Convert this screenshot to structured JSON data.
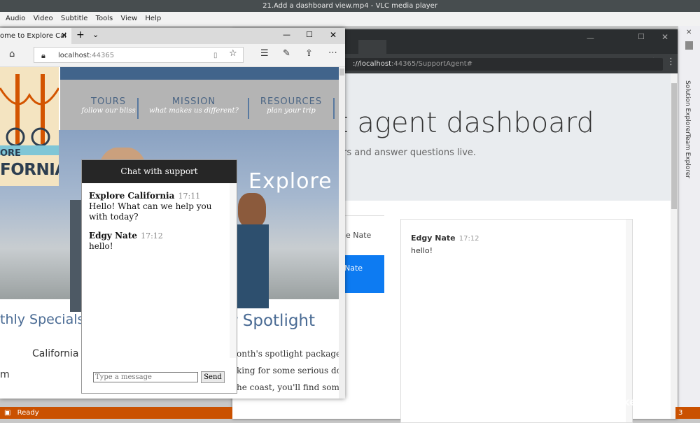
{
  "vlc": {
    "title": "21.Add a dashboard view.mp4 - VLC media player",
    "menu": [
      "Audio",
      "Video",
      "Subtitle",
      "Tools",
      "View",
      "Help"
    ]
  },
  "vs": {
    "tabs": [
      "Solution Explorer",
      "Team Explorer"
    ],
    "status": "Ready",
    "status_right": "3"
  },
  "chrome": {
    "url_prefix": "://localhost",
    "url_suffix": ":44365/SupportAgent#",
    "dash_title": "t agent dashboard",
    "dash_subtitle": "ers and answer questions live.",
    "agent_inactive": "he Nate",
    "agent_active": "Nate",
    "messages": [
      {
        "name": "Edgy Nate",
        "time": "17:12",
        "text": "hello!"
      }
    ]
  },
  "edge": {
    "tab_title": "ome to Explore Cal",
    "url_host": "localhost",
    "url_port": ":44365"
  },
  "page": {
    "nav": [
      {
        "title": "TOURS",
        "sub": "follow our bliss"
      },
      {
        "title": "MISSION",
        "sub": "what makes us different?"
      },
      {
        "title": "RESOURCES",
        "sub": "plan your trip"
      }
    ],
    "logo_top": "ORE",
    "logo_bottom": "FORNIA",
    "hero_text": "Explore",
    "monthly": "thly Specials",
    "spotlight": "r Spotlight",
    "california": "California",
    "spot_lines": [
      "onth's spotlight package is",
      "king for some serious dow",
      "he coast, you'll find someth"
    ]
  },
  "chat": {
    "header": "Chat with support",
    "messages": [
      {
        "name": "Explore California",
        "time": "17:11",
        "text": "Hello! What can we help you with today?"
      },
      {
        "name": "Edgy Nate",
        "time": "17:12",
        "text": "hello!"
      }
    ],
    "input_placeholder": "Type a message",
    "send_label": "Send"
  },
  "watermark": "LinkedIn"
}
